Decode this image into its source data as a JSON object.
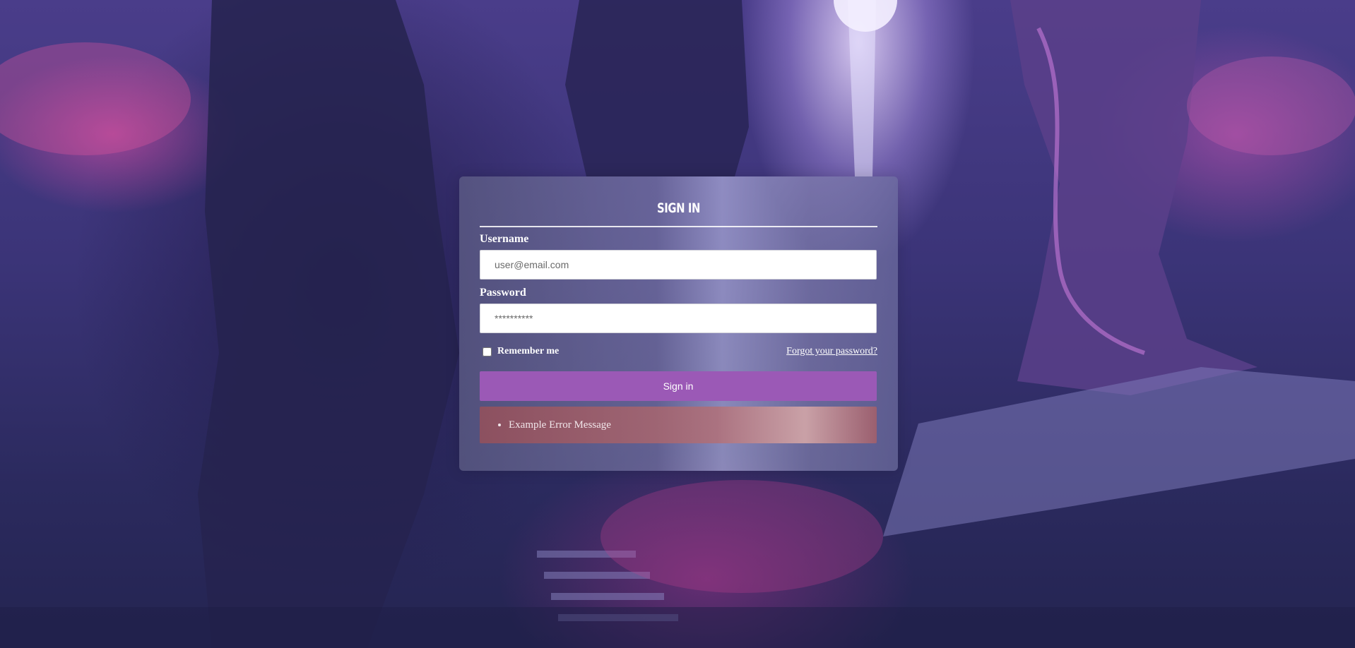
{
  "login": {
    "title": "SIGN IN",
    "username_label": "Username",
    "username_placeholder": "user@email.com",
    "password_label": "Password",
    "password_placeholder": "**********",
    "remember_label": "Remember me",
    "forgot_link": "Forgot your password?",
    "submit_label": "Sign in",
    "errors": [
      "Example Error Message"
    ]
  },
  "theme": {
    "accent": "#9b59b6",
    "error_bg": "#a86470"
  }
}
